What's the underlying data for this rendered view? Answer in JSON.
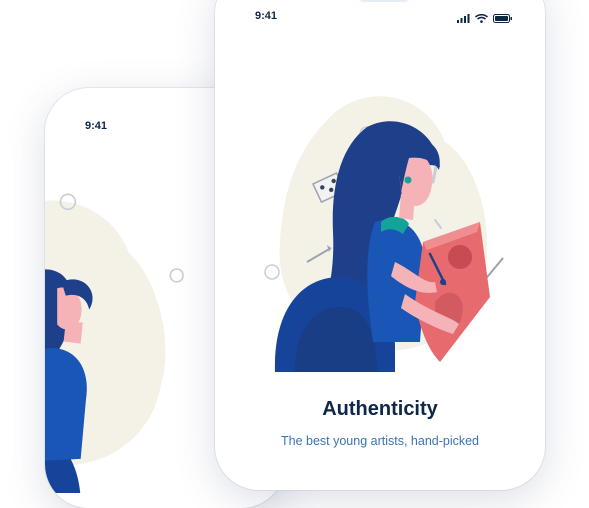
{
  "back_phone": {
    "time": "9:41"
  },
  "front_phone": {
    "time": "9:41",
    "title": "Authenticity",
    "subtitle": "The best young artists, hand-picked"
  },
  "icons": [
    "signal-icon",
    "wifi-icon",
    "battery-icon"
  ],
  "colors": {
    "navy": "#0e2746",
    "accent_blue": "#3a74b8",
    "hair_blue": "#1e3f8a",
    "chair_blue": "#16449a",
    "canvas_pink": "#e76a6f",
    "skin_pink": "#f5b3b8",
    "blob_cream": "#f4f1e7"
  }
}
